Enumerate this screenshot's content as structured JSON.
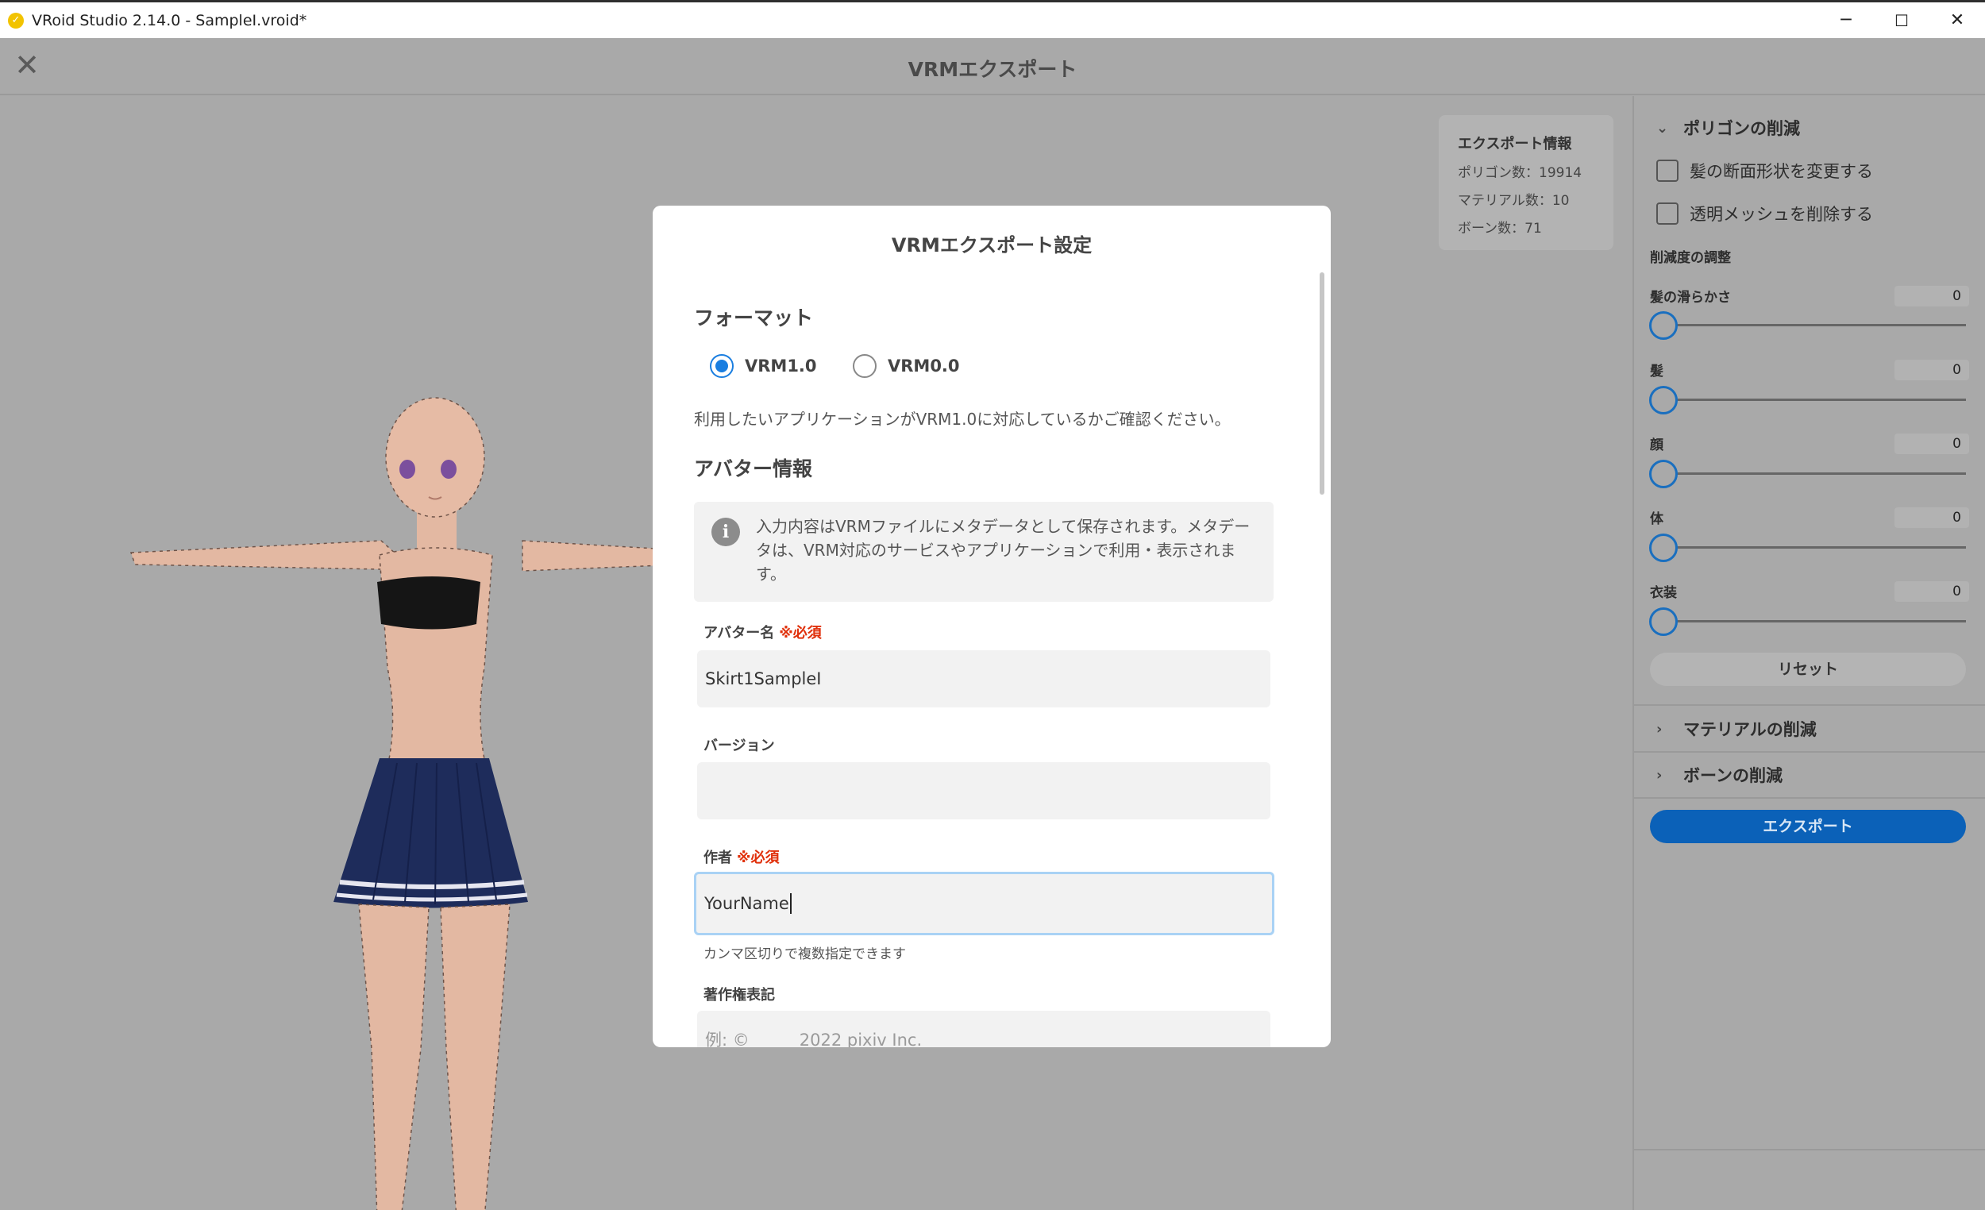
{
  "window": {
    "title": "VRoid Studio 2.14.0 - SampleI.vroid*",
    "app_icon": "vroid-logo-icon",
    "controls": {
      "minimize": "─",
      "maximize": "☐",
      "close": "✕"
    }
  },
  "header": {
    "close_icon": "✕",
    "title": "VRMエクスポート"
  },
  "export_info": {
    "title": "エクスポート情報",
    "polygons": "ポリゴン数：19914",
    "materials": "マテリアル数：10",
    "bones": "ボーン数：71"
  },
  "right_panel": {
    "polygon_section": {
      "title": "ポリゴンの削減",
      "expanded": true,
      "checkboxes": [
        {
          "label": "髪の断面形状を変更する",
          "checked": false
        },
        {
          "label": "透明メッシュを削除する",
          "checked": false
        }
      ],
      "adjust_title": "削減度の調整",
      "sliders": [
        {
          "label": "髪の滑らかさ",
          "value": "0"
        },
        {
          "label": "髪",
          "value": "0"
        },
        {
          "label": "顔",
          "value": "0"
        },
        {
          "label": "体",
          "value": "0"
        },
        {
          "label": "衣装",
          "value": "0"
        }
      ],
      "reset_label": "リセット"
    },
    "material_section": {
      "title": "マテリアルの削減"
    },
    "bone_section": {
      "title": "ボーンの削減"
    },
    "export_label": "エクスポート",
    "colors": {
      "accent": "#0b61b8",
      "slider": "#1a6fbf"
    }
  },
  "modal": {
    "title": "VRMエクスポート設定",
    "format": {
      "heading": "フォーマット",
      "options": [
        {
          "label": "VRM1.0",
          "selected": true
        },
        {
          "label": "VRM0.0",
          "selected": false
        }
      ],
      "note": "利用したいアプリケーションがVRM1.0に対応しているかご確認ください。"
    },
    "avatar_info": {
      "heading": "アバター情報",
      "notice": "入力内容はVRMファイルにメタデータとして保存されます。メタデータは、VRM対応のサービスやアプリケーションで利用・表示されます。",
      "required_mark": "※必須",
      "fields": {
        "name": {
          "label": "アバター名",
          "value": "Skirt1SampleI"
        },
        "version": {
          "label": "バージョン",
          "value": ""
        },
        "author": {
          "label": "作者",
          "value": "YourName",
          "hint": "カンマ区切りで複数指定できます"
        },
        "copyright": {
          "label": "著作権表記",
          "placeholder": "例: ©　　　2022 pixiv Inc."
        }
      }
    },
    "colors": {
      "radio": "#1a7ee0",
      "required": "#e0300b",
      "focus": "#a9d2f5"
    }
  }
}
